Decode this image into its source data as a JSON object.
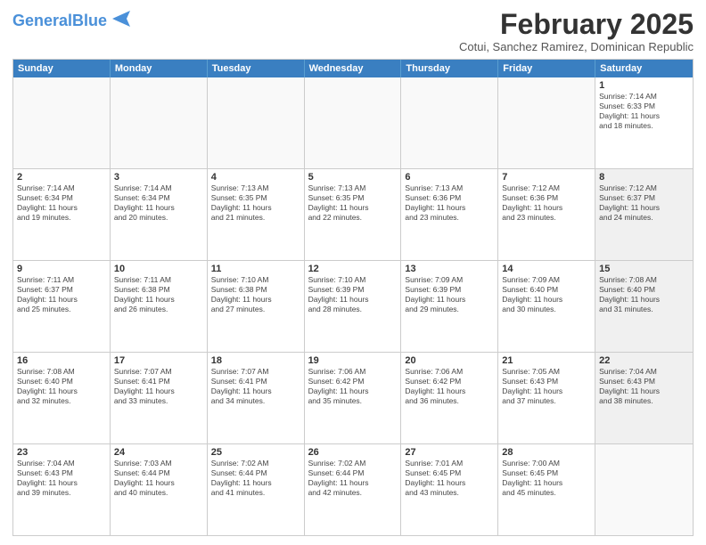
{
  "header": {
    "logo_general": "General",
    "logo_blue": "Blue",
    "month_title": "February 2025",
    "location": "Cotui, Sanchez Ramirez, Dominican Republic"
  },
  "weekdays": [
    "Sunday",
    "Monday",
    "Tuesday",
    "Wednesday",
    "Thursday",
    "Friday",
    "Saturday"
  ],
  "rows": [
    [
      {
        "day": "",
        "empty": true
      },
      {
        "day": "",
        "empty": true
      },
      {
        "day": "",
        "empty": true
      },
      {
        "day": "",
        "empty": true
      },
      {
        "day": "",
        "empty": true
      },
      {
        "day": "",
        "empty": true
      },
      {
        "day": "1",
        "info": "Sunrise: 7:14 AM\nSunset: 6:33 PM\nDaylight: 11 hours\nand 18 minutes."
      }
    ],
    [
      {
        "day": "2",
        "info": "Sunrise: 7:14 AM\nSunset: 6:34 PM\nDaylight: 11 hours\nand 19 minutes."
      },
      {
        "day": "3",
        "info": "Sunrise: 7:14 AM\nSunset: 6:34 PM\nDaylight: 11 hours\nand 20 minutes."
      },
      {
        "day": "4",
        "info": "Sunrise: 7:13 AM\nSunset: 6:35 PM\nDaylight: 11 hours\nand 21 minutes."
      },
      {
        "day": "5",
        "info": "Sunrise: 7:13 AM\nSunset: 6:35 PM\nDaylight: 11 hours\nand 22 minutes."
      },
      {
        "day": "6",
        "info": "Sunrise: 7:13 AM\nSunset: 6:36 PM\nDaylight: 11 hours\nand 23 minutes."
      },
      {
        "day": "7",
        "info": "Sunrise: 7:12 AM\nSunset: 6:36 PM\nDaylight: 11 hours\nand 23 minutes."
      },
      {
        "day": "8",
        "info": "Sunrise: 7:12 AM\nSunset: 6:37 PM\nDaylight: 11 hours\nand 24 minutes.",
        "shaded": true
      }
    ],
    [
      {
        "day": "9",
        "info": "Sunrise: 7:11 AM\nSunset: 6:37 PM\nDaylight: 11 hours\nand 25 minutes."
      },
      {
        "day": "10",
        "info": "Sunrise: 7:11 AM\nSunset: 6:38 PM\nDaylight: 11 hours\nand 26 minutes."
      },
      {
        "day": "11",
        "info": "Sunrise: 7:10 AM\nSunset: 6:38 PM\nDaylight: 11 hours\nand 27 minutes."
      },
      {
        "day": "12",
        "info": "Sunrise: 7:10 AM\nSunset: 6:39 PM\nDaylight: 11 hours\nand 28 minutes."
      },
      {
        "day": "13",
        "info": "Sunrise: 7:09 AM\nSunset: 6:39 PM\nDaylight: 11 hours\nand 29 minutes."
      },
      {
        "day": "14",
        "info": "Sunrise: 7:09 AM\nSunset: 6:40 PM\nDaylight: 11 hours\nand 30 minutes."
      },
      {
        "day": "15",
        "info": "Sunrise: 7:08 AM\nSunset: 6:40 PM\nDaylight: 11 hours\nand 31 minutes.",
        "shaded": true
      }
    ],
    [
      {
        "day": "16",
        "info": "Sunrise: 7:08 AM\nSunset: 6:40 PM\nDaylight: 11 hours\nand 32 minutes."
      },
      {
        "day": "17",
        "info": "Sunrise: 7:07 AM\nSunset: 6:41 PM\nDaylight: 11 hours\nand 33 minutes."
      },
      {
        "day": "18",
        "info": "Sunrise: 7:07 AM\nSunset: 6:41 PM\nDaylight: 11 hours\nand 34 minutes."
      },
      {
        "day": "19",
        "info": "Sunrise: 7:06 AM\nSunset: 6:42 PM\nDaylight: 11 hours\nand 35 minutes."
      },
      {
        "day": "20",
        "info": "Sunrise: 7:06 AM\nSunset: 6:42 PM\nDaylight: 11 hours\nand 36 minutes."
      },
      {
        "day": "21",
        "info": "Sunrise: 7:05 AM\nSunset: 6:43 PM\nDaylight: 11 hours\nand 37 minutes."
      },
      {
        "day": "22",
        "info": "Sunrise: 7:04 AM\nSunset: 6:43 PM\nDaylight: 11 hours\nand 38 minutes.",
        "shaded": true
      }
    ],
    [
      {
        "day": "23",
        "info": "Sunrise: 7:04 AM\nSunset: 6:43 PM\nDaylight: 11 hours\nand 39 minutes."
      },
      {
        "day": "24",
        "info": "Sunrise: 7:03 AM\nSunset: 6:44 PM\nDaylight: 11 hours\nand 40 minutes."
      },
      {
        "day": "25",
        "info": "Sunrise: 7:02 AM\nSunset: 6:44 PM\nDaylight: 11 hours\nand 41 minutes."
      },
      {
        "day": "26",
        "info": "Sunrise: 7:02 AM\nSunset: 6:44 PM\nDaylight: 11 hours\nand 42 minutes."
      },
      {
        "day": "27",
        "info": "Sunrise: 7:01 AM\nSunset: 6:45 PM\nDaylight: 11 hours\nand 43 minutes."
      },
      {
        "day": "28",
        "info": "Sunrise: 7:00 AM\nSunset: 6:45 PM\nDaylight: 11 hours\nand 45 minutes."
      },
      {
        "day": "",
        "empty": true
      }
    ]
  ]
}
